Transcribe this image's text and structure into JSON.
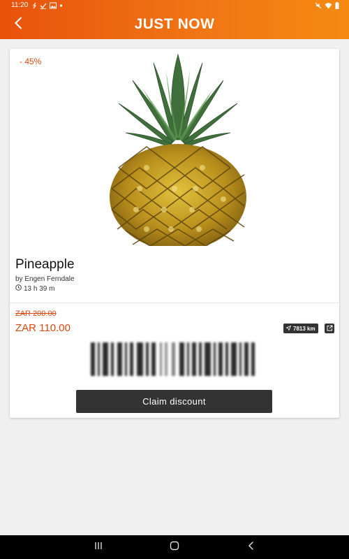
{
  "status_bar": {
    "time": "11:20",
    "left_icons": [
      "phone-missed-icon",
      "check-icon",
      "image-icon",
      "dot-icon"
    ],
    "right_icons": [
      "mute-icon",
      "wifi-icon",
      "battery-icon"
    ]
  },
  "header": {
    "title": "JUST NOW",
    "back_icon": "chevron-left-icon"
  },
  "product": {
    "discount_label": "- 45%",
    "name": "Pineapple",
    "vendor_text": "by Engen Ferndale",
    "time_remaining": "13 h 39 m",
    "original_price": "ZAR 200.00",
    "discounted_price": "ZAR 110.00",
    "distance": "7813 km",
    "claim_label": "Claim discount"
  },
  "colors": {
    "accent_orange": "#e8520c",
    "price_red": "#d9470c",
    "button_dark": "#333333"
  },
  "nav_bar": {
    "icons": [
      "recents-icon",
      "home-icon",
      "back-icon"
    ]
  }
}
